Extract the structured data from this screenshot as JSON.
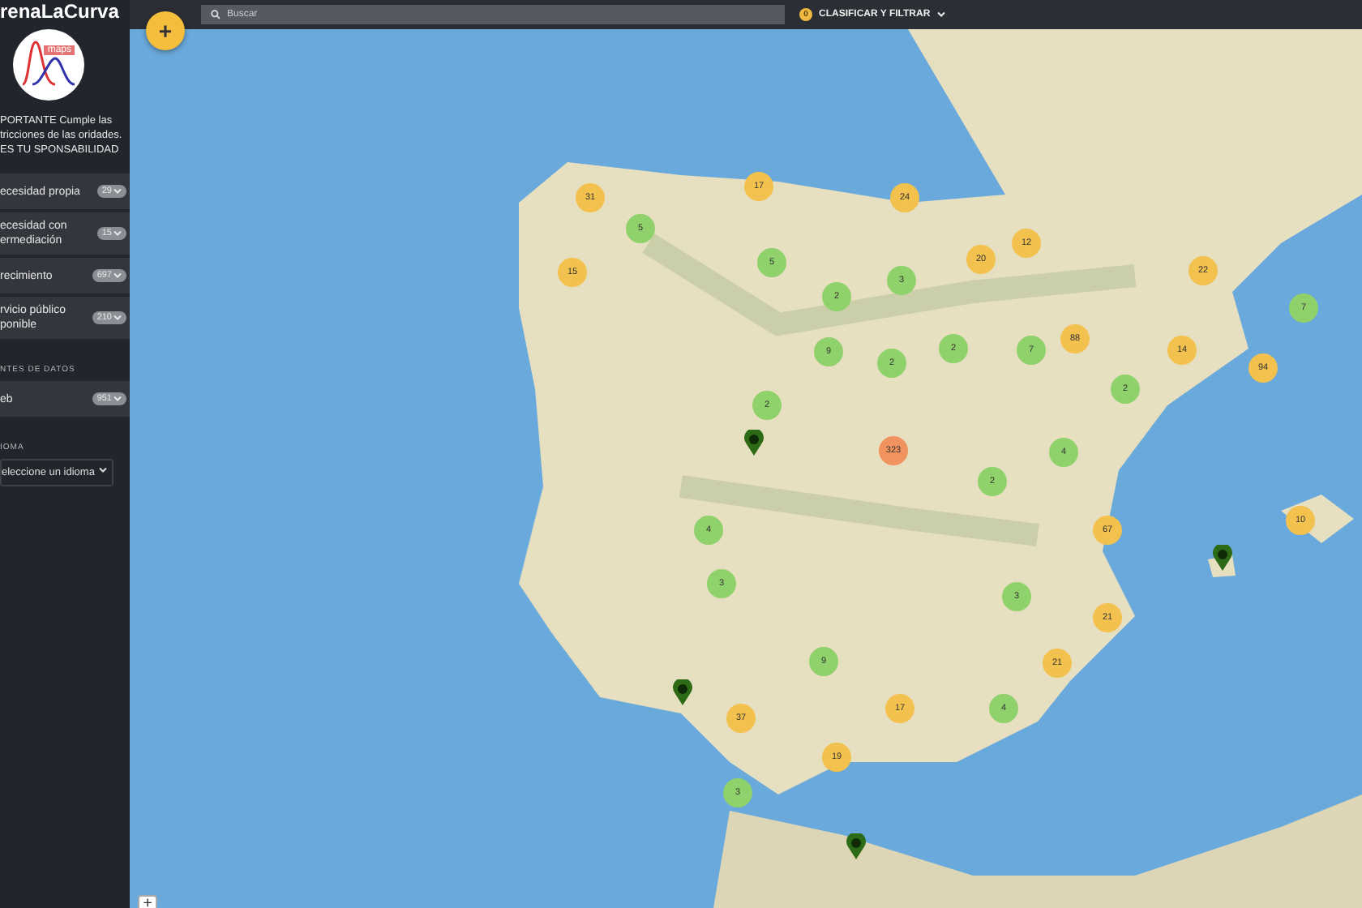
{
  "sidebar": {
    "title": "renaLaCurva",
    "logo_text": "maps",
    "notice": "PORTANTE Cumple las tricciones de las oridades. ES TU SPONSABILIDAD",
    "categories": [
      {
        "label": "ecesidad propia",
        "count": "29"
      },
      {
        "label": "ecesidad con ermediación",
        "count": "15"
      },
      {
        "label": "recimiento",
        "count": "697"
      },
      {
        "label": "rvicio público ponible",
        "count": "210"
      }
    ],
    "sources_heading": "NTES DE DATOS",
    "sources": [
      {
        "label": "eb",
        "count": "951"
      }
    ],
    "language_heading": "IOMA",
    "language_select": {
      "value": "eleccione un idioma"
    }
  },
  "topbar": {
    "search": {
      "placeholder": "Buscar"
    },
    "filter_button": {
      "badge": "0",
      "label": "CLASIFICAR Y FILTRAR"
    }
  },
  "add_button": {
    "label": "+"
  },
  "zoom_button": {
    "label": "+"
  },
  "map": {
    "clusters": [
      {
        "count": "31",
        "color": "#f2c14e"
      },
      {
        "count": "17",
        "color": "#f2c14e"
      },
      {
        "count": "24",
        "color": "#f2c14e"
      },
      {
        "count": "5",
        "color": "#8fd16a"
      },
      {
        "count": "12",
        "color": "#f2c14e"
      },
      {
        "count": "15",
        "color": "#f2c14e"
      },
      {
        "count": "5",
        "color": "#8fd16a"
      },
      {
        "count": "20",
        "color": "#f2c14e"
      },
      {
        "count": "22",
        "color": "#f2c14e"
      },
      {
        "count": "3",
        "color": "#8fd16a"
      },
      {
        "count": "2",
        "color": "#8fd16a"
      },
      {
        "count": "7",
        "color": "#8fd16a"
      },
      {
        "count": "88",
        "color": "#f2c14e"
      },
      {
        "count": "9",
        "color": "#8fd16a"
      },
      {
        "count": "2",
        "color": "#8fd16a"
      },
      {
        "count": "7",
        "color": "#8fd16a"
      },
      {
        "count": "14",
        "color": "#f2c14e"
      },
      {
        "count": "2",
        "color": "#8fd16a"
      },
      {
        "count": "94",
        "color": "#f2c14e"
      },
      {
        "count": "2",
        "color": "#8fd16a"
      },
      {
        "count": "2",
        "color": "#8fd16a"
      },
      {
        "count": "323",
        "color": "#f0935f"
      },
      {
        "count": "4",
        "color": "#8fd16a"
      },
      {
        "count": "2",
        "color": "#8fd16a"
      },
      {
        "count": "10",
        "color": "#f2c14e"
      },
      {
        "count": "4",
        "color": "#8fd16a"
      },
      {
        "count": "67",
        "color": "#f2c14e"
      },
      {
        "count": "3",
        "color": "#8fd16a"
      },
      {
        "count": "3",
        "color": "#8fd16a"
      },
      {
        "count": "21",
        "color": "#f2c14e"
      },
      {
        "count": "9",
        "color": "#8fd16a"
      },
      {
        "count": "21",
        "color": "#f2c14e"
      },
      {
        "count": "17",
        "color": "#f2c14e"
      },
      {
        "count": "4",
        "color": "#8fd16a"
      },
      {
        "count": "37",
        "color": "#f2c14e"
      },
      {
        "count": "19",
        "color": "#f2c14e"
      },
      {
        "count": "3",
        "color": "#8fd16a"
      }
    ]
  }
}
